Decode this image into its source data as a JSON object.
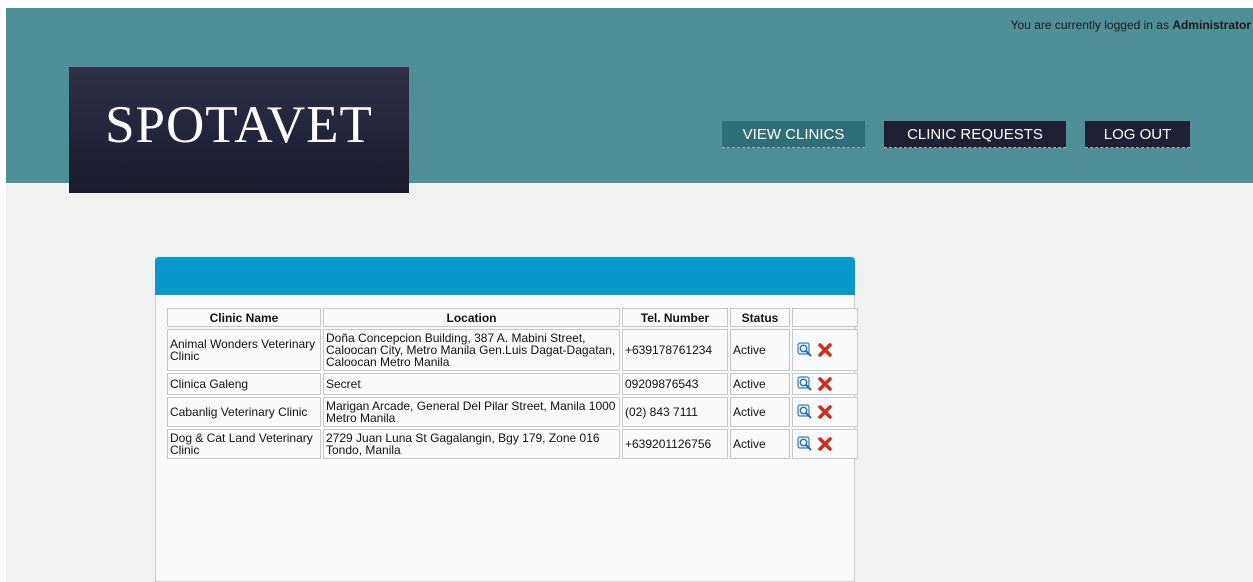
{
  "header": {
    "login_prefix": "You are currently logged in as ",
    "login_user": "Administrator",
    "logo": "SPOTAVET",
    "nav": {
      "view_clinics": "VIEW CLINICS",
      "clinic_requests": "CLINIC REQUESTS",
      "log_out": "LOG OUT"
    }
  },
  "table": {
    "headers": {
      "name": "Clinic Name",
      "location": "Location",
      "tel": "Tel. Number",
      "status": "Status"
    },
    "rows": [
      {
        "name": "Animal Wonders Veterinary Clinic",
        "location": "Doña Concepcion Building, 387 A. Mabini Street, Caloocan City, Metro Manila Gen.Luis Dagat-Dagatan, Caloocan Metro Manila",
        "tel": "+639178761234",
        "status": "Active"
      },
      {
        "name": "Clinica Galeng",
        "location": "Secret",
        "tel": "09209876543",
        "status": "Active"
      },
      {
        "name": "Cabanlig Veterinary Clinic",
        "location": "Marigan Arcade, General Del Pilar Street, Manila 1000 Metro Manila",
        "tel": "(02) 843 7111",
        "status": "Active"
      },
      {
        "name": "Dog & Cat Land Veterinary Clinic",
        "location": "2729 Juan Luna St Gagalangin, Bgy 179, Zone 016 Tondo, Manila",
        "tel": "+639201126756",
        "status": "Active"
      }
    ],
    "icons": {
      "view": "magnifier-view-icon",
      "delete": "red-x-delete-icon"
    }
  },
  "colors": {
    "header_bg": "#4f8f96",
    "logo_bg": "#1e2034",
    "panel_head": "#0899cc",
    "delete_red": "#d42a1c"
  }
}
